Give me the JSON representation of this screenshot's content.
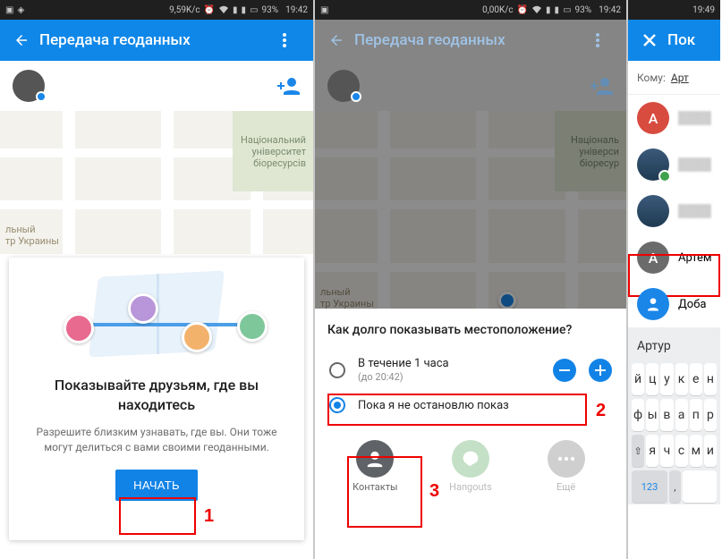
{
  "phone1": {
    "status": {
      "speed": "9,59K/c",
      "battery": "93%",
      "time": "19:42"
    },
    "appbar": {
      "title": "Передача геоданных"
    },
    "map": {
      "park_label": "Національний\nуніверситет\nбіоресурсів",
      "center_label": "льный\nтр Украины"
    },
    "card": {
      "title": "Показывайте друзьям, где вы находитесь",
      "body": "Разрешите близким узнавать, где вы. Они тоже могут делиться с вами своими геоданными.",
      "button": "НАЧАТЬ"
    },
    "annotation": "1"
  },
  "phone2": {
    "status": {
      "speed": "0,00K/c",
      "battery": "93%",
      "time": "19:42"
    },
    "appbar": {
      "title": "Передача геоданных"
    },
    "map": {
      "park_label": "Національ\nуніверси\nбіоресур",
      "center_label": "льный\nтр Украины"
    },
    "sheet": {
      "title": "Как долго показывать местоположение?",
      "opt1": {
        "label": "В течение 1 часа",
        "sub": "(до 20:42)"
      },
      "opt2": {
        "label": "Пока я не остановлю показ"
      },
      "share": [
        {
          "icon": "contacts",
          "label": "Контакты"
        },
        {
          "icon": "hangouts",
          "label": "Hangouts"
        },
        {
          "icon": "more",
          "label": "Ещё"
        }
      ]
    },
    "ann2": "2",
    "ann3": "3"
  },
  "phone3": {
    "status": {
      "time": "19:49"
    },
    "appbar": {
      "title": "Пок"
    },
    "to_label": "Кому:",
    "to_chip": "Арт",
    "contacts": [
      {
        "initial": "А",
        "color": "#d84b3f",
        "name": ""
      },
      {
        "initial": "",
        "color": "#3b5a7a",
        "name": "",
        "badge": "#3fa24c"
      },
      {
        "initial": "",
        "color": "#3b5a7a",
        "name": ""
      },
      {
        "initial": "А",
        "color": "#6b6b6b",
        "name": "Артем"
      },
      {
        "initial": "",
        "color": "#1a86e8",
        "name": "Доба",
        "add": true
      }
    ],
    "keyboard": {
      "suggestion": "Артур",
      "row1": [
        "й",
        "ц",
        "у",
        "к",
        "е",
        "н"
      ],
      "row2": [
        "ф",
        "ы",
        "в",
        "а",
        "п",
        "р"
      ],
      "row3": [
        "⇧",
        "я",
        "ч",
        "с",
        "м",
        "и"
      ],
      "row4_fn": "123"
    }
  }
}
